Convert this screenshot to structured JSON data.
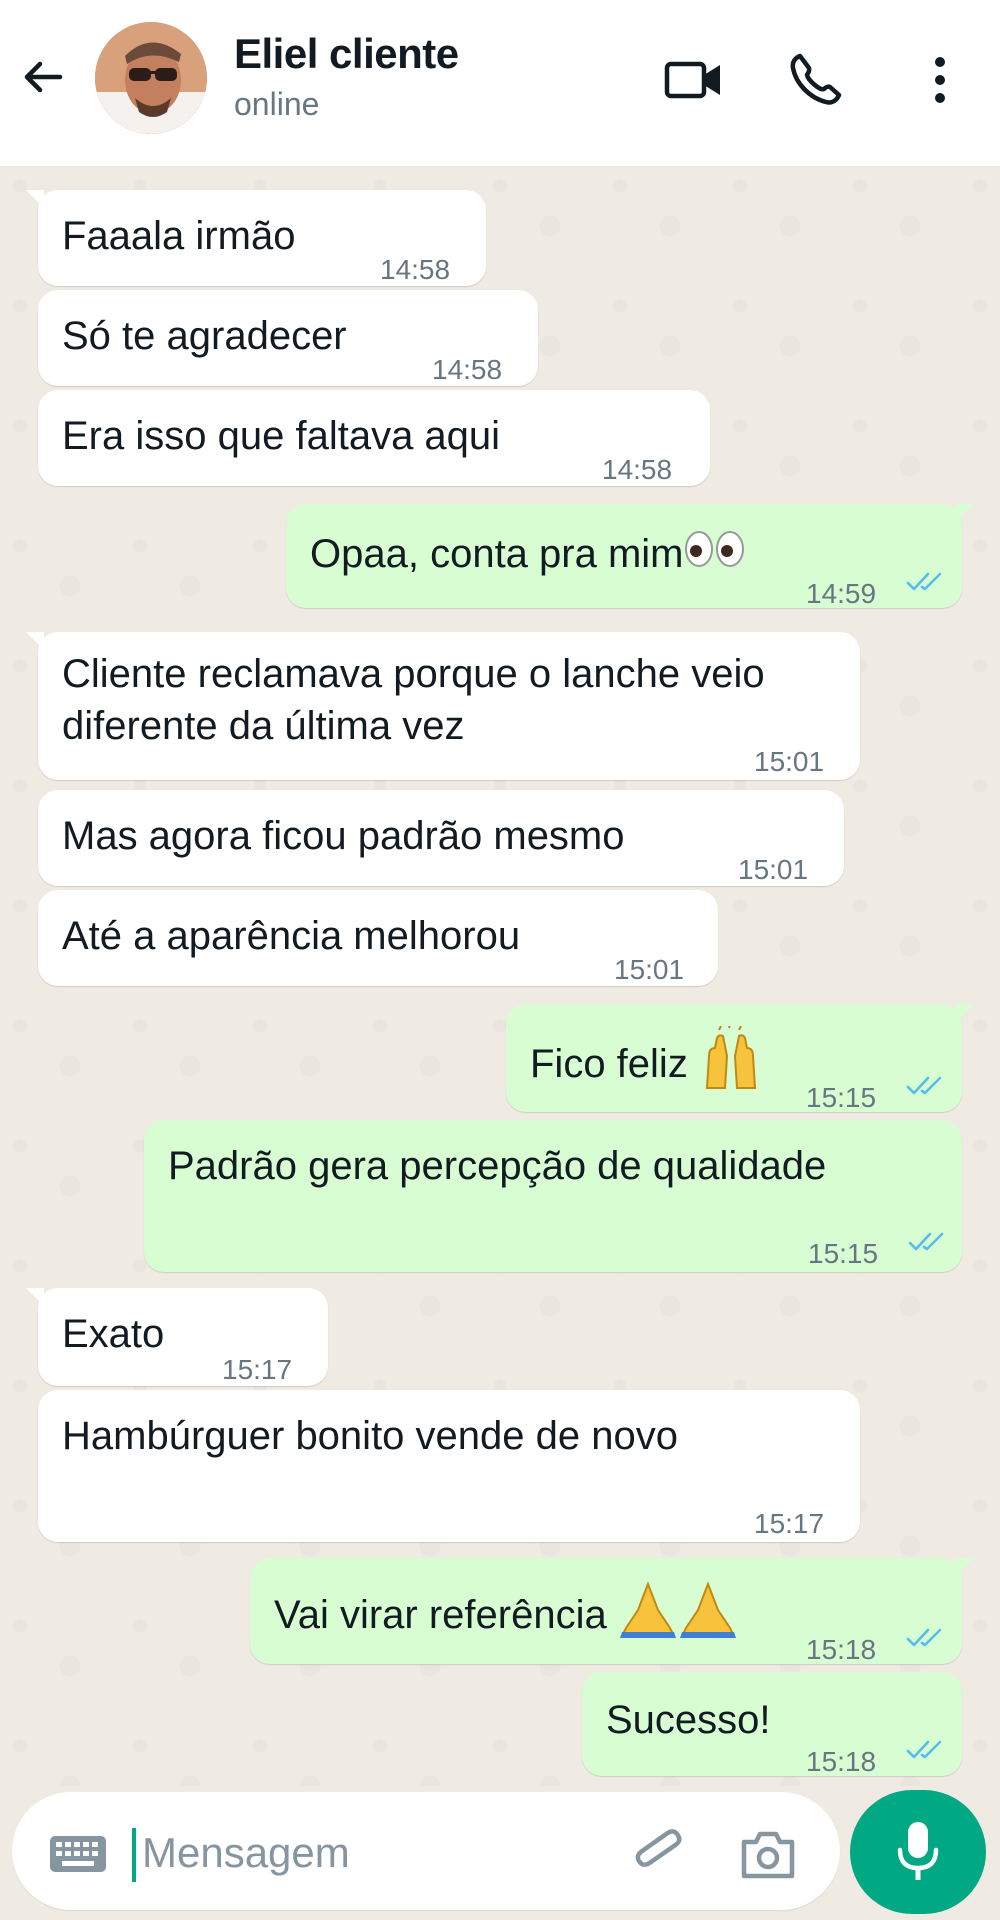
{
  "header": {
    "back_icon": "arrow-left-icon",
    "contact_name": "Eliel cliente",
    "status": "online",
    "actions": [
      "video-camera-icon",
      "phone-icon",
      "more-vertical-icon"
    ]
  },
  "messages": [
    {
      "dir": "in",
      "text": "Faaala irmão",
      "time": "14:58"
    },
    {
      "dir": "in",
      "text": "Só te agradecer",
      "time": "14:58"
    },
    {
      "dir": "in",
      "text": "Era isso que faltava aqui",
      "time": "14:58"
    },
    {
      "dir": "out",
      "text": "Opaa, conta pra mim",
      "emoji": "👀",
      "time": "14:59",
      "status": "read"
    },
    {
      "dir": "in",
      "text_line1": "Cliente reclamava porque o lanche veio",
      "text_line2": "diferente da última vez",
      "time": "15:01"
    },
    {
      "dir": "in",
      "text": "Mas agora ficou padrão mesmo",
      "time": "15:01"
    },
    {
      "dir": "in",
      "text": "Até a aparência melhorou",
      "time": "15:01"
    },
    {
      "dir": "out",
      "text": "Fico feliz ",
      "emoji": "🙌",
      "time": "15:15",
      "status": "read"
    },
    {
      "dir": "out",
      "text": "Padrão gera percepção de qualidade",
      "time": "15:15",
      "status": "read"
    },
    {
      "dir": "in",
      "text": "Exato",
      "time": "15:17"
    },
    {
      "dir": "in",
      "text": "Hambúrguer bonito vende de novo",
      "time": "15:17"
    },
    {
      "dir": "out",
      "text": "Vai virar referência ",
      "emoji": "🙏🙏",
      "time": "15:18",
      "status": "read"
    },
    {
      "dir": "out",
      "text": "Sucesso!",
      "time": "15:18",
      "status": "read"
    }
  ],
  "composer": {
    "placeholder": "Mensagem",
    "icons": [
      "keyboard-icon",
      "paperclip-icon",
      "camera-icon",
      "microphone-icon"
    ]
  },
  "colors": {
    "incoming_bubble": "#ffffff",
    "outgoing_bubble": "#d9fdd3",
    "chat_background": "#efeae2",
    "accent": "#00a884",
    "read_ticks": "#53bdeb"
  }
}
